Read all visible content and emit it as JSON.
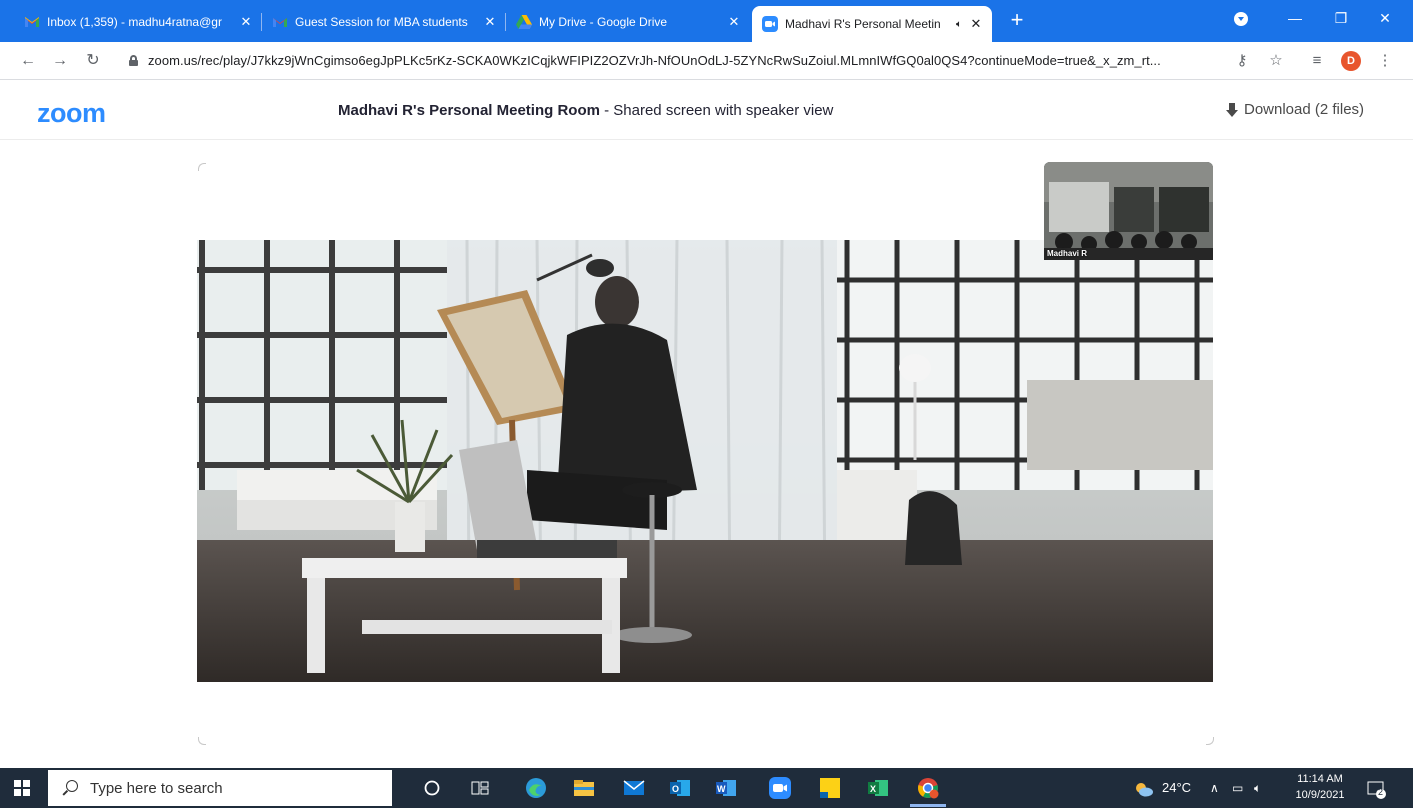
{
  "browser": {
    "tabs": [
      {
        "title": "Inbox (1,359) - madhu4ratna@gr",
        "icon": "gmail-icon",
        "active": false
      },
      {
        "title": "Guest Session for MBA students",
        "icon": "gmail-icon",
        "active": false
      },
      {
        "title": "My Drive - Google Drive",
        "icon": "google-drive-icon",
        "active": false
      },
      {
        "title": "Madhavi R's Personal Meetin",
        "icon": "zoom-icon",
        "active": true
      }
    ],
    "url": "zoom.us/rec/play/J7kkz9jWnCgimso6egJpPLKc5rKz-SCKA0WKzICqjkWFIPIZ2OZVrJh-NfOUnOdLJ-5ZYNcRwSuZoiul.MLmnIWfGQ0al0QS4?continueMode=true&_x_zm_rt...",
    "profile_initial": "D",
    "accent_color": "#1a73e8"
  },
  "zoom": {
    "logo": "zoom",
    "title_bold": "Madhavi R's Personal Meeting Room",
    "title_rest": " - Shared screen with speaker view",
    "download_label": "Download (2 files)",
    "speaker_name": "Madhavi R",
    "brand_color": "#2d8cff"
  },
  "taskbar": {
    "search_placeholder": "Type here to search",
    "weather": "24°C",
    "time": "11:14 AM",
    "date": "10/9/2021",
    "notification_count": "2",
    "apps": [
      "cortana-icon",
      "task-view-icon",
      "edge-icon",
      "file-explorer-icon",
      "mail-icon",
      "outlook-icon",
      "word-icon",
      "zoom-icon",
      "sticky-notes-icon",
      "excel-icon",
      "chrome-icon"
    ]
  }
}
